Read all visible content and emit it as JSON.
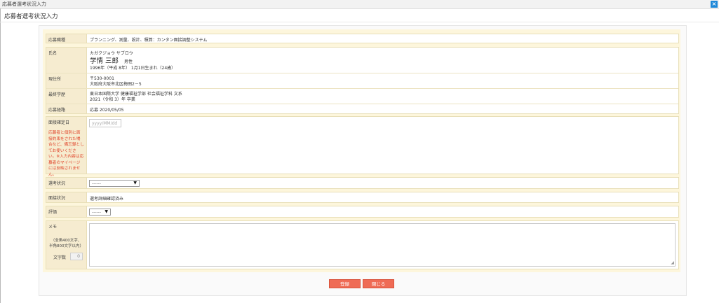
{
  "window": {
    "title": "応募者選考状況入力",
    "close_label": "×"
  },
  "page_title": "応募者選考状況入力",
  "job": {
    "label": "応募職種",
    "value": "プランニング、測量、設計、積算：カンタン面接調整システム"
  },
  "applicant": {
    "name_label": "氏名",
    "kana": "カガクジョウ サブロウ",
    "name": "学情 三郎",
    "gender": "男性",
    "birth": "1996年（平成 8年） 1月1日生まれ（24歳）",
    "address_label": "現住所",
    "postal": "〒530-0001",
    "address": "大阪府大阪市北区梅田2－5",
    "edu_label": "最終学歴",
    "school": "東日本国際大学 健康福祉学部 社会福祉学科 文系",
    "graduation": "2021（令和 3）年 卒業",
    "route_label": "応募経路",
    "route": "応募 2020/05/05"
  },
  "interview": {
    "label": "面接確定日",
    "warning": "応募者と個別に面接約束をされた場合など、備忘録としてお使いください。※入力内容は応募者のマイページには反映されません。",
    "date_placeholder": "yyyy/MM/dd"
  },
  "selection": {
    "label": "選考状況",
    "value": "------"
  },
  "interview_status": {
    "label": "面接状況",
    "value": "選考詳細確認済み"
  },
  "rating": {
    "label": "評価",
    "value": "------"
  },
  "memo": {
    "label": "メモ",
    "note_line1": "（全角400文字、",
    "note_line2": "半角800文字以内）",
    "count_label": "文字数",
    "count": "0"
  },
  "buttons": {
    "register": "登録",
    "close": "閉じる"
  },
  "colors": {
    "accent": "#1e88d8",
    "button": "#ef6b55",
    "warning": "#e0442a",
    "panel": "#fdf6dc"
  }
}
